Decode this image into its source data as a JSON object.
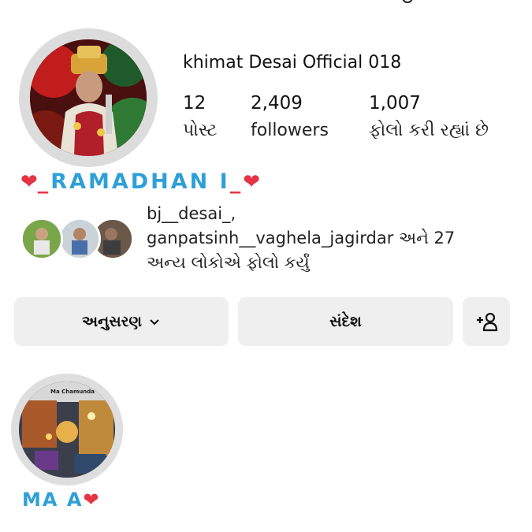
{
  "profile": {
    "username": "khimat Desai Official 018",
    "bio": "RAMADHAN I",
    "bio_heart": "❤",
    "bio_dash": "_"
  },
  "stats": [
    {
      "value": "12",
      "label": "પોસ્ટ"
    },
    {
      "value": "2,409",
      "label": "followers"
    },
    {
      "value": "1,007",
      "label": "ફોલો કરી રહ્યાં છે"
    }
  ],
  "followed_by": {
    "users_line": "bj__desai_,",
    "users_line2": "ganpatsinh__vaghela_jagirdar અને 27",
    "tail": "અન્ય લોકોએ ફોલો કર્યું"
  },
  "buttons": {
    "follow_label": "અનુસરણ",
    "follow_icon": "chevron-down-icon",
    "message_label": "સંદેશ",
    "add_user_icon": "add-user-icon"
  },
  "highlights": [
    {
      "label": "MA A",
      "heart": "❤",
      "image_text": "Ma Chamunda"
    }
  ],
  "colors": {
    "bio_accent": "#2f9fd8",
    "heart": "#e53344",
    "button_bg": "#efefef",
    "ring": "#dcdcdc"
  }
}
